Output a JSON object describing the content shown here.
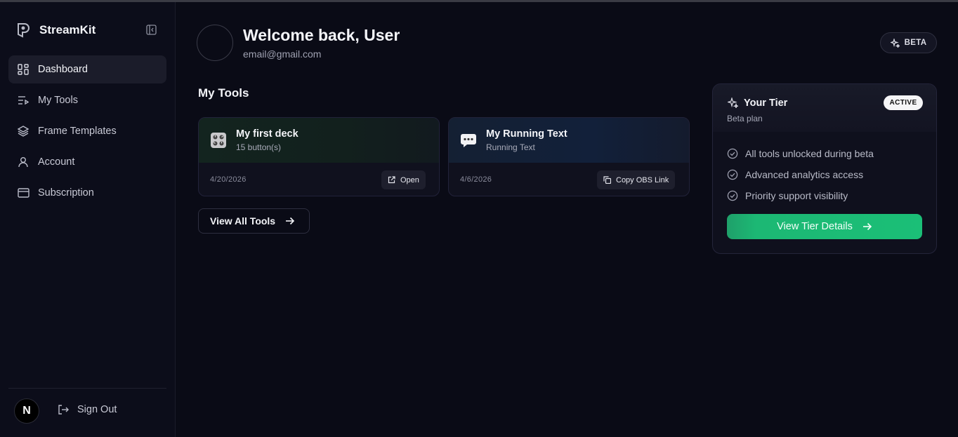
{
  "sidebar": {
    "brand": "StreamKit",
    "items": [
      {
        "label": "Dashboard",
        "icon": "dashboard-icon",
        "active": true
      },
      {
        "label": "My Tools",
        "icon": "list-play-icon",
        "active": false
      },
      {
        "label": "Frame Templates",
        "icon": "layers-icon",
        "active": false
      },
      {
        "label": "Account",
        "icon": "user-icon",
        "active": false
      },
      {
        "label": "Subscription",
        "icon": "credit-card-icon",
        "active": false
      }
    ],
    "avatar_initial": "N",
    "sign_out": "Sign Out"
  },
  "header": {
    "welcome": "Welcome back, User",
    "email": "email@gmail.com",
    "beta_badge": "BETA"
  },
  "tools": {
    "title": "My Tools",
    "cards": [
      {
        "name": "My first deck",
        "subtitle": "15 button(s)",
        "date": "4/20/2026",
        "action": "Open",
        "icon": "control-knobs-emoji"
      },
      {
        "name": "My Running Text",
        "subtitle": "Running Text",
        "date": "4/6/2026",
        "action": "Copy OBS Link",
        "icon": "speech-bubble-emoji"
      }
    ],
    "view_all": "View All Tools"
  },
  "tier": {
    "title": "Your Tier",
    "plan": "Beta plan",
    "status": "ACTIVE",
    "features": [
      "All tools unlocked during beta",
      "Advanced analytics access",
      "Priority support visibility"
    ],
    "button": "View Tier Details"
  },
  "colors": {
    "background": "#0a0b16",
    "accent_green": "#1bbf77",
    "card_border": "#22233a"
  }
}
